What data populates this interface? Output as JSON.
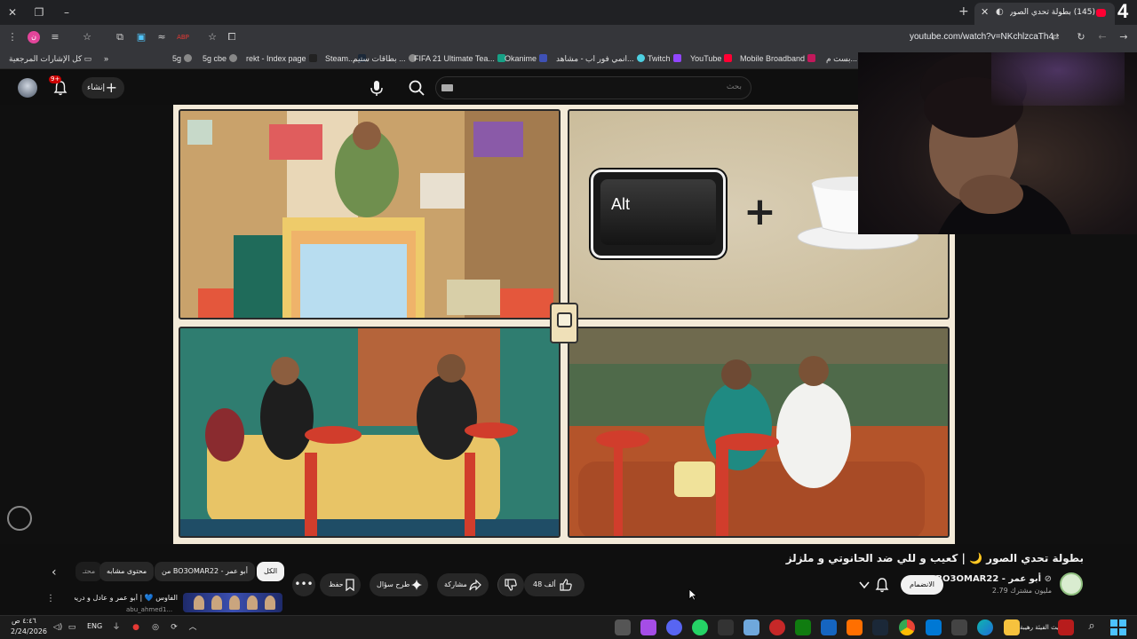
{
  "browser": {
    "tab_count": "4",
    "active_tab_title": "(145) بطولة تحدي الصور 🌙",
    "url": "youtube.com/watch?v=NKchlzcaTh4",
    "extension_badge": "ن"
  },
  "bookmarks": {
    "all_bookmarks": "كل الإشارات المرجعية",
    "items": [
      "5g",
      "5g cbe",
      "rekt - Index page",
      "Steam...",
      "بطاقات ستيم ...",
      "FIFA 21 Ultimate Tea...",
      "Okanime",
      "انمي فور اب - مشاهد...",
      "Twitch",
      "YouTube",
      "Mobile Broadband",
      "بست م..."
    ]
  },
  "youtube_header": {
    "notification_badge": "9+",
    "create_label": "إنشاء",
    "search_placeholder": "بحث"
  },
  "video_frame": {
    "key_label": "Alt",
    "plus": "+"
  },
  "video_info": {
    "title": "بطولة تحدي الصور 🌙 | كعيب و للي ضد الحانوتي و ملزلز",
    "channel_name": "BO3OMAR22 - أبو عمر",
    "subscribers": "2.79 مليون مشترك",
    "join_label": "الانضمام",
    "likes": "48 ألف",
    "share_label": "مشاركة",
    "ask_label": "طرح سؤال",
    "save_label": "حفظ",
    "more_label": "•••",
    "chips": {
      "all": "الكل",
      "from": "من BO3OMAR22 - أبو عمر",
      "related": "محتوى مشابه",
      "more": "محتـ"
    },
    "related": {
      "title": "الفاوس 💙 | أبو عمر و عادل و دريحه",
      "channel": "abu_ahmed1..."
    }
  },
  "taskbar": {
    "time": "٤:٤٦ ص",
    "date": "2/24/2026",
    "language": "ENG",
    "news_text": "تحديث الفيئة رهيبة"
  }
}
